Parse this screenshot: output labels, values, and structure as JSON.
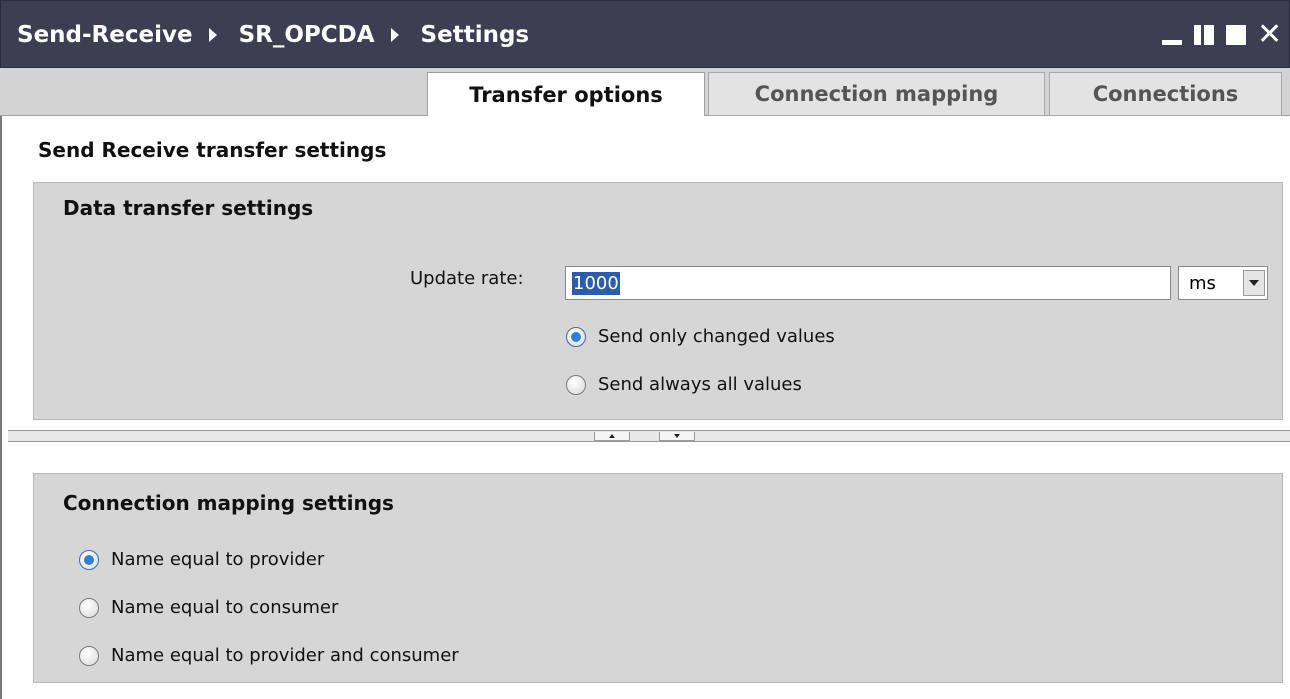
{
  "titlebar": {
    "breadcrumb": [
      "Send-Receive",
      "SR_OPCDA",
      "Settings"
    ]
  },
  "tabs": [
    {
      "label": "Transfer options",
      "active": true
    },
    {
      "label": "Connection mapping",
      "active": false
    },
    {
      "label": "Connections",
      "active": false
    }
  ],
  "section_title": "Send Receive transfer settings",
  "data_transfer": {
    "title": "Data transfer settings",
    "update_rate_label": "Update rate:",
    "update_rate_value": "1000",
    "unit": "ms",
    "options": [
      {
        "label": "Send only changed values",
        "selected": true
      },
      {
        "label": "Send always all values",
        "selected": false
      }
    ]
  },
  "connection_mapping": {
    "title": "Connection mapping settings",
    "options": [
      {
        "label": "Name equal to provider",
        "selected": true
      },
      {
        "label": "Name equal to consumer",
        "selected": false
      },
      {
        "label": "Name equal to provider and consumer",
        "selected": false
      }
    ]
  },
  "icons": {
    "minimize": "minimize-icon",
    "float": "float-window-icon",
    "maximize": "maximize-icon",
    "close": "close-icon",
    "breadcrumb_separator": "triangle-right-icon",
    "splitter_up": "arrow-up-icon",
    "splitter_down": "arrow-down-icon"
  },
  "colors": {
    "titlebar": "#3c3f52",
    "panel": "#d6d6d6",
    "selection": "#2a5db0",
    "radio_dot": "#2f7fd4"
  }
}
